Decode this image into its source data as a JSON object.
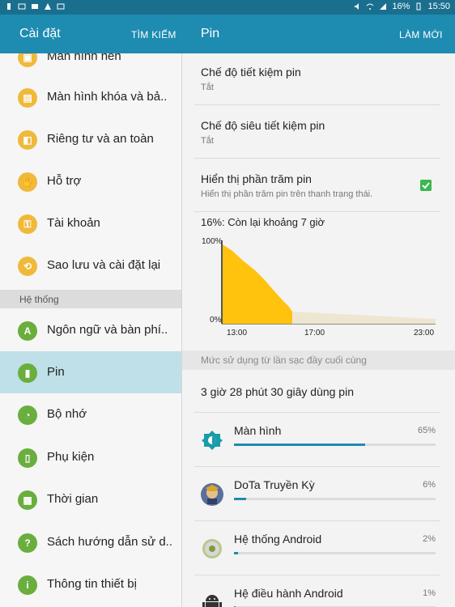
{
  "status_bar": {
    "battery_text": "16%",
    "time": "15:50"
  },
  "left_header": {
    "title": "Cài đặt",
    "action": "TÌM KIẾM"
  },
  "right_header": {
    "title": "Pin",
    "action": "LÀM MỚI"
  },
  "sidebar": {
    "items": [
      {
        "label": "Màn hình nền",
        "icon": "wallpaper-icon",
        "color": "#f0b93a"
      },
      {
        "label": "Màn hình khóa và bả..",
        "icon": "lock-icon",
        "color": "#f0b93a"
      },
      {
        "label": "Riêng tư và an toàn",
        "icon": "privacy-icon",
        "color": "#f0b93a"
      },
      {
        "label": "Hỗ trợ",
        "icon": "hand-icon",
        "color": "#f0b93a"
      },
      {
        "label": "Tài khoản",
        "icon": "key-icon",
        "color": "#f0b93a"
      },
      {
        "label": "Sao lưu và cài đặt lại",
        "icon": "backup-icon",
        "color": "#f0b93a"
      }
    ],
    "section_header": "Hệ thống",
    "system_items": [
      {
        "label": "Ngôn ngữ và bàn phí..",
        "icon": "language-icon",
        "color": "#6aae3e"
      },
      {
        "label": "Pin",
        "icon": "battery-icon",
        "color": "#6aae3e",
        "selected": true
      },
      {
        "label": "Bộ nhớ",
        "icon": "storage-icon",
        "color": "#6aae3e"
      },
      {
        "label": "Phụ kiện",
        "icon": "accessory-icon",
        "color": "#6aae3e"
      },
      {
        "label": "Thời gian",
        "icon": "calendar-icon",
        "color": "#6aae3e"
      },
      {
        "label": "Sách hướng dẫn sử d..",
        "icon": "manual-icon",
        "color": "#6aae3e"
      },
      {
        "label": "Thông tin thiết bị",
        "icon": "info-icon",
        "color": "#6aae3e"
      }
    ]
  },
  "battery": {
    "power_saving": {
      "title": "Chế độ tiết kiệm pin",
      "value": "Tắt"
    },
    "ultra_power_saving": {
      "title": "Chế độ siêu tiết kiệm pin",
      "value": "Tắt"
    },
    "show_percent": {
      "title": "Hiển thị phần trăm pin",
      "desc": "Hiển thị phần trăm pin trên thanh trạng thái.",
      "checked": true
    },
    "summary": "16%: Còn lại khoảng 7 giờ",
    "chart": {
      "y_top": "100%",
      "y_bottom": "0%",
      "x_labels": [
        "13:00",
        "17:00",
        "23:00"
      ]
    },
    "usage_header": "Mức sử dụng từ lần sạc đầy cuối cùng",
    "total_usage": "3 giờ 28 phút 30 giây dùng pin",
    "usage": [
      {
        "name": "Màn hình",
        "percent": "65%",
        "value": 65,
        "icon": "brightness-icon"
      },
      {
        "name": "DoTa Truyền Kỳ",
        "percent": "6%",
        "value": 6,
        "icon": "game-icon"
      },
      {
        "name": "Hệ thống Android",
        "percent": "2%",
        "value": 2,
        "icon": "android-system-icon"
      },
      {
        "name": "Hệ điều hành Android",
        "percent": "1%",
        "value": 1,
        "icon": "android-os-icon"
      }
    ]
  },
  "colors": {
    "status_bar": "#1a6f8f",
    "app_bar": "#1e8bb1",
    "selected_item": "#bfe0e8",
    "chart_fill": "#ffc30d",
    "chart_projection": "#efe6d2",
    "accent": "#1e8bb1"
  }
}
